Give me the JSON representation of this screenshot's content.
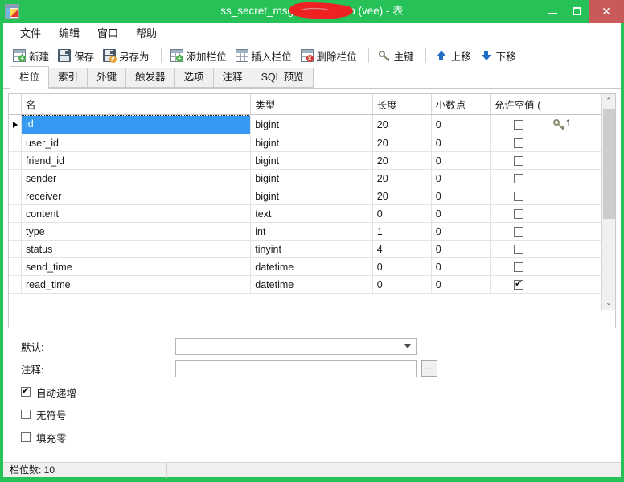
{
  "window": {
    "title": "ss_secret_msg @s          e_demo (vee) - 表",
    "app_icon": "table-edit-icon",
    "redaction_color": "#ee2222",
    "frame_color": "#26c258",
    "close_color": "#c95a5a",
    "controls": {
      "minimize": "minimize-icon",
      "maximize": "maximize-icon",
      "close": "close-icon"
    }
  },
  "menubar": {
    "items": [
      {
        "label": "文件",
        "name": "menu-file"
      },
      {
        "label": "编辑",
        "name": "menu-edit"
      },
      {
        "label": "窗口",
        "name": "menu-window"
      },
      {
        "label": "帮助",
        "name": "menu-help"
      }
    ]
  },
  "toolbar": {
    "groups": [
      {
        "buttons": [
          {
            "label": "新建",
            "icon": "new-table-icon"
          },
          {
            "label": "保存",
            "icon": "save-icon"
          },
          {
            "label": "另存为",
            "icon": "save-as-icon"
          }
        ]
      },
      {
        "buttons": [
          {
            "label": "添加栏位",
            "icon": "add-field-icon"
          },
          {
            "label": "插入栏位",
            "icon": "insert-field-icon"
          },
          {
            "label": "删除栏位",
            "icon": "delete-field-icon"
          }
        ]
      },
      {
        "buttons": [
          {
            "label": "主键",
            "icon": "key-icon"
          }
        ]
      },
      {
        "buttons": [
          {
            "label": "上移",
            "icon": "arrow-up-icon"
          },
          {
            "label": "下移",
            "icon": "arrow-down-icon"
          }
        ]
      }
    ]
  },
  "tabs": {
    "active": "栏位",
    "items": [
      {
        "label": "栏位",
        "name": "tab-fields",
        "active": true
      },
      {
        "label": "索引",
        "name": "tab-indexes",
        "active": false
      },
      {
        "label": "外键",
        "name": "tab-foreign-keys",
        "active": false
      },
      {
        "label": "触发器",
        "name": "tab-triggers",
        "active": false
      },
      {
        "label": "选项",
        "name": "tab-options",
        "active": false
      },
      {
        "label": "注释",
        "name": "tab-comment",
        "active": false
      },
      {
        "label": "SQL 预览",
        "name": "tab-sql-preview",
        "active": false
      }
    ]
  },
  "grid": {
    "columns": [
      {
        "label": "名",
        "name": "col-name"
      },
      {
        "label": "类型",
        "name": "col-type"
      },
      {
        "label": "长度",
        "name": "col-length"
      },
      {
        "label": "小数点",
        "name": "col-decimals"
      },
      {
        "label": "允许空值 (",
        "name": "col-allow-null"
      },
      {
        "label": "",
        "name": "col-primary-key"
      }
    ],
    "selected_row": 0,
    "selected_cell": "id",
    "rows": [
      {
        "name": "id",
        "type": "bigint",
        "length": "20",
        "decimals": "0",
        "allow_null": false,
        "pk": "1"
      },
      {
        "name": "user_id",
        "type": "bigint",
        "length": "20",
        "decimals": "0",
        "allow_null": false,
        "pk": ""
      },
      {
        "name": "friend_id",
        "type": "bigint",
        "length": "20",
        "decimals": "0",
        "allow_null": false,
        "pk": ""
      },
      {
        "name": "sender",
        "type": "bigint",
        "length": "20",
        "decimals": "0",
        "allow_null": false,
        "pk": ""
      },
      {
        "name": "receiver",
        "type": "bigint",
        "length": "20",
        "decimals": "0",
        "allow_null": false,
        "pk": ""
      },
      {
        "name": "content",
        "type": "text",
        "length": "0",
        "decimals": "0",
        "allow_null": false,
        "pk": ""
      },
      {
        "name": "type",
        "type": "int",
        "length": "1",
        "decimals": "0",
        "allow_null": false,
        "pk": ""
      },
      {
        "name": "status",
        "type": "tinyint",
        "length": "4",
        "decimals": "0",
        "allow_null": false,
        "pk": ""
      },
      {
        "name": "send_time",
        "type": "datetime",
        "length": "0",
        "decimals": "0",
        "allow_null": false,
        "pk": ""
      },
      {
        "name": "read_time",
        "type": "datetime",
        "length": "0",
        "decimals": "0",
        "allow_null": true,
        "pk": ""
      }
    ],
    "scrollbar": {
      "up_icon": "chevron-up-icon",
      "down_icon": "chevron-down-icon"
    }
  },
  "form": {
    "default_label": "默认:",
    "default_value": "",
    "comment_label": "注释:",
    "comment_value": "",
    "comment_browse_label": "...",
    "checkboxes": [
      {
        "label": "自动递增",
        "name": "auto-increment-checkbox",
        "checked": true
      },
      {
        "label": "无符号",
        "name": "unsigned-checkbox",
        "checked": false
      },
      {
        "label": "填充零",
        "name": "zerofill-checkbox",
        "checked": false
      }
    ]
  },
  "statusbar": {
    "field_count": "栏位数: 10"
  }
}
